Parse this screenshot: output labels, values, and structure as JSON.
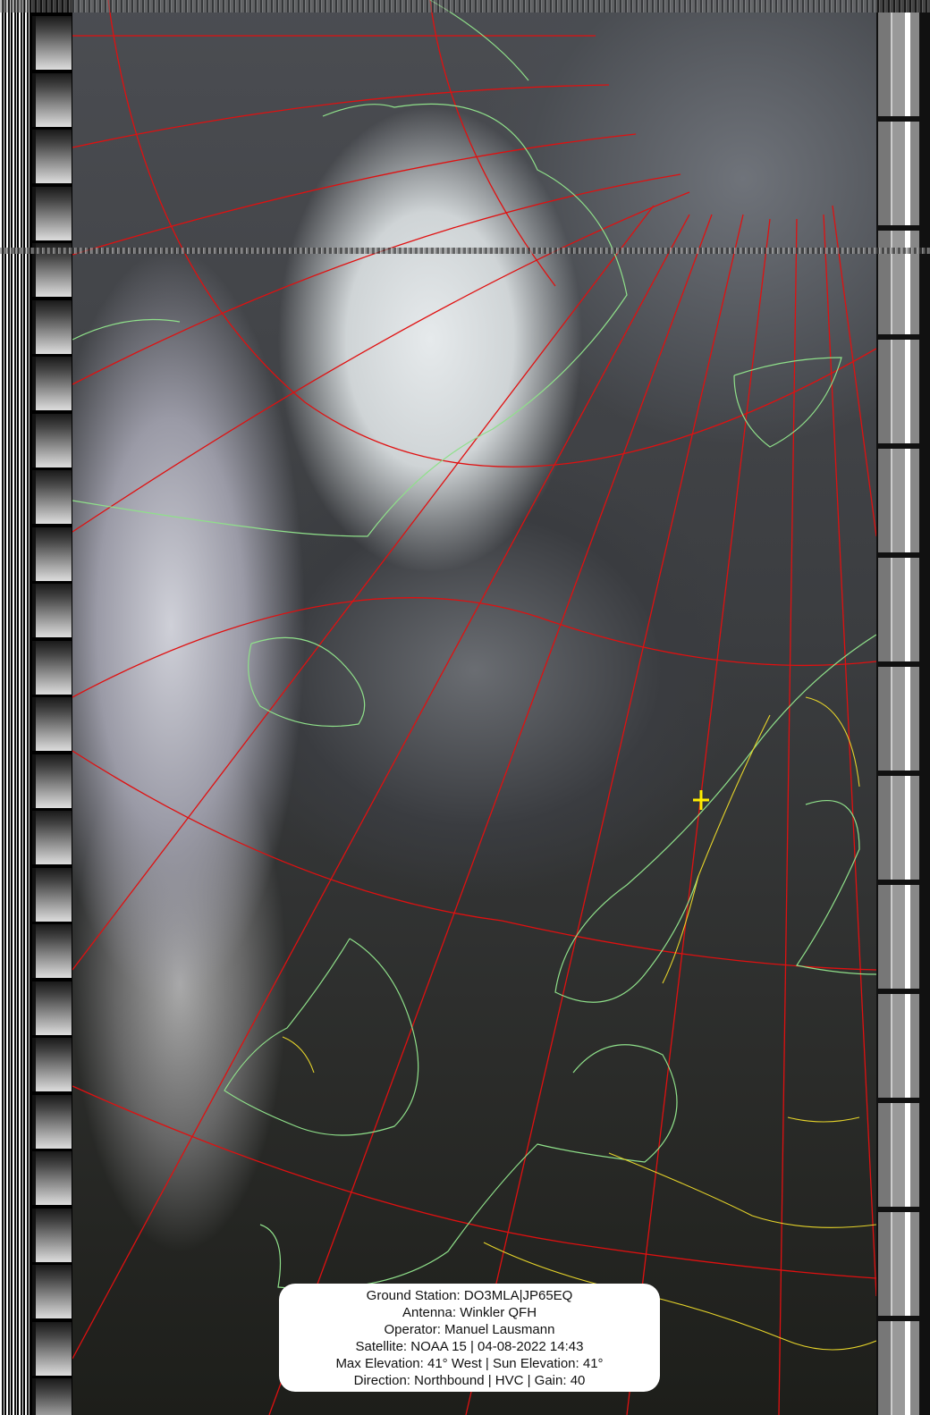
{
  "info_box": {
    "ground_station": "Ground Station: DO3MLA|JP65EQ",
    "antenna": "Antenna: Winkler QFH",
    "operator": "Operator: Manuel Lausmann",
    "satellite": "Satellite: NOAA 15 | 04-08-2022 14:43",
    "elevation": "Max Elevation: 41° West | Sun Elevation: 41°",
    "direction": "Direction: Northbound | HVC | Gain: 40"
  },
  "colors": {
    "graticule": "#e01010",
    "coastline": "#8fe08a",
    "borders": "#e6d42a",
    "station_marker": "#ffee00"
  }
}
